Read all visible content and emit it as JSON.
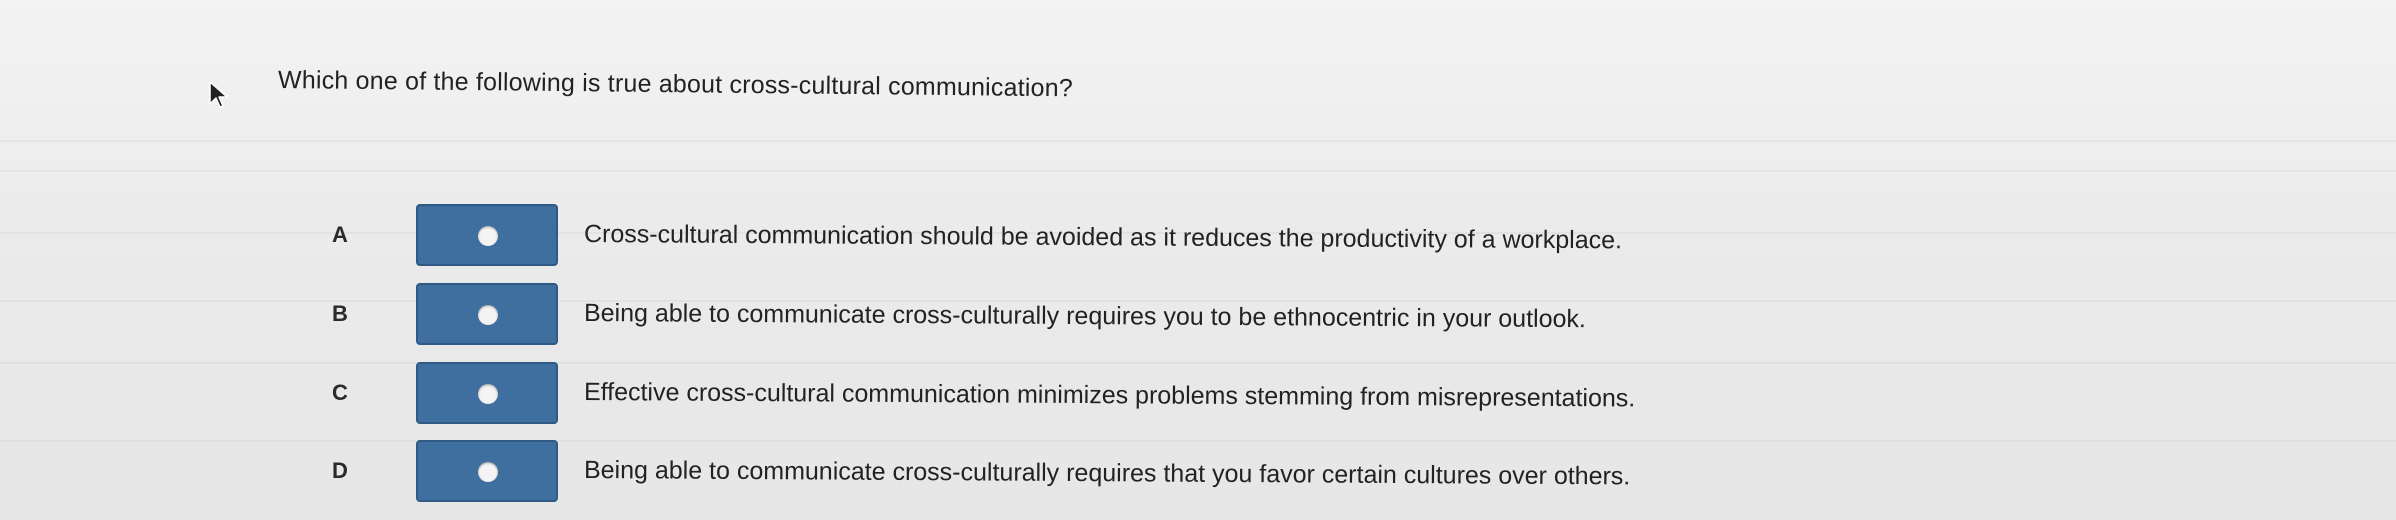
{
  "question": {
    "text": "Which one of the following is true about cross-cultural communication?"
  },
  "options": [
    {
      "letter": "A",
      "text": "Cross-cultural communication should be avoided as it reduces the productivity of a workplace.",
      "selected": false
    },
    {
      "letter": "B",
      "text": "Being able to communicate cross-culturally requires you to be ethnocentric in your outlook.",
      "selected": false
    },
    {
      "letter": "C",
      "text": "Effective cross-cultural communication minimizes problems stemming from misrepresentations.",
      "selected": false
    },
    {
      "letter": "D",
      "text": "Being able to communicate cross-culturally requires that you favor certain cultures over others.",
      "selected": false
    }
  ],
  "colors": {
    "radio_button_fill": "#3f6f9f",
    "radio_dot": "#f4f4f4",
    "background": "#ebebeb"
  },
  "icons": {
    "cursor": "mouse-pointer-icon"
  }
}
